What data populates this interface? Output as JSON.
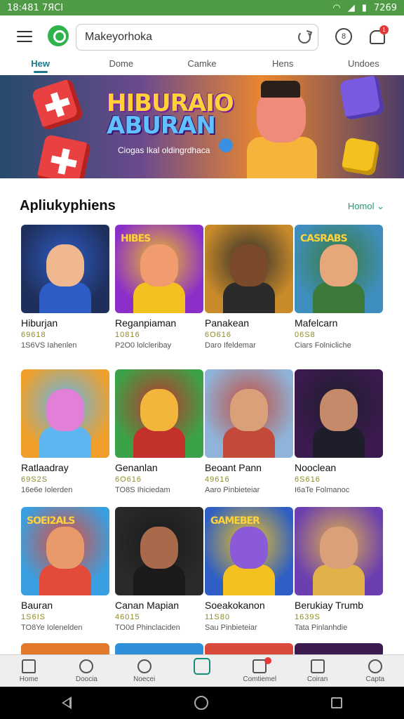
{
  "status_bar": {
    "time": "18:481 7ЯСІ",
    "right_text": "7269"
  },
  "search": {
    "value": "Makeyorhoka"
  },
  "profile_icon_text": "8",
  "notification_badge": "1",
  "tabs": [
    {
      "label": "Hew",
      "active": true
    },
    {
      "label": "Dome"
    },
    {
      "label": "Camke"
    },
    {
      "label": "Hens"
    },
    {
      "label": "Undoes"
    }
  ],
  "banner": {
    "title_line1": "HIBURAIO",
    "title_line2": "ABURAN",
    "subtitle": "Ciogas Ikal oldingrdhaca"
  },
  "section": {
    "title": "Apliukyphiens",
    "more_label": "Homol"
  },
  "apps": [
    {
      "name": "Hiburjan",
      "rating": "69618",
      "meta": "1S6VS Iahenlen",
      "thumb_label": "",
      "bg": "#1f2f5c",
      "c1": "#f0b88f",
      "c2": "#2d5cc4"
    },
    {
      "name": "Reganpiaman",
      "rating": "10816",
      "meta": "P2O0 lolcleribay",
      "thumb_label": "HIBES",
      "bg": "#8b2fc9",
      "c1": "#f09c6f",
      "c2": "#f3c21f"
    },
    {
      "name": "Panakean",
      "rating": "6O616",
      "meta": "Daro Ifeldemar",
      "thumb_label": "",
      "bg": "#c98b2a",
      "c1": "#7a4a2a",
      "c2": "#2b2b2b"
    },
    {
      "name": "Mafelcarn",
      "rating": "06S8",
      "meta": "Ciars Folnicliche",
      "thumb_label": "CASRABS",
      "bg": "#3e8fbf",
      "c1": "#e6a77a",
      "c2": "#3c7a3a"
    },
    {
      "name": "Ratlaadray",
      "rating": "69S2S",
      "meta": "16e6e Iolerden",
      "thumb_label": "",
      "bg": "#f0a02a",
      "c1": "#e27fd9",
      "c2": "#5fb5f0"
    },
    {
      "name": "Genanlan",
      "rating": "6O616",
      "meta": "TO8S Ihiciedam",
      "thumb_label": "",
      "bg": "#3aa34a",
      "c1": "#f3b63a",
      "c2": "#c3312d"
    },
    {
      "name": "Beoant Pann",
      "rating": "49616",
      "meta": "Aaro Pinbieteiar",
      "thumb_label": "",
      "bg": "#8fb3d9",
      "c1": "#d9a07a",
      "c2": "#c24a3a"
    },
    {
      "name": "Nooclean",
      "rating": "6S616",
      "meta": "I6aTe Folmanoc",
      "thumb_label": "",
      "bg": "#3b1a4f",
      "c1": "#c48a6a",
      "c2": "#1e1e2a"
    },
    {
      "name": "Bauran",
      "rating": "1S6IS",
      "meta": "TO8Ye Iolenelden",
      "thumb_label": "SOEI2ALS",
      "bg": "#3a9fe0",
      "c1": "#e89a6a",
      "c2": "#e24a3a"
    },
    {
      "name": "Canan Mapian",
      "rating": "46015",
      "meta": "TO0d Phinclaciden",
      "thumb_label": "",
      "bg": "#2a2a2a",
      "c1": "#a86a4a",
      "c2": "#1a1a1a"
    },
    {
      "name": "Soeakokanon",
      "rating": "11S80",
      "meta": "Sau Pinbieteiar",
      "thumb_label": "GAMEBER",
      "bg": "#2f5fc4",
      "c1": "#8a5ad9",
      "c2": "#f3c21f"
    },
    {
      "name": "Berukiay Trumb",
      "rating": "1639S",
      "meta": "Tata Pinlanhdie",
      "thumb_label": "",
      "bg": "#6b3fb0",
      "c1": "#d9a07a",
      "c2": "#e2b24a"
    }
  ],
  "bottom_nav": [
    {
      "label": "Home",
      "icon": "home-icon"
    },
    {
      "label": "Doocia",
      "icon": "search-icon"
    },
    {
      "label": "Noecei",
      "icon": "search-person-icon"
    },
    {
      "label": "",
      "icon": "app-center-icon",
      "active": true
    },
    {
      "label": "Comtiemel",
      "icon": "folder-icon",
      "badge": true
    },
    {
      "label": "Coiran",
      "icon": "list-icon"
    },
    {
      "label": "Capta",
      "icon": "search-icon"
    }
  ]
}
